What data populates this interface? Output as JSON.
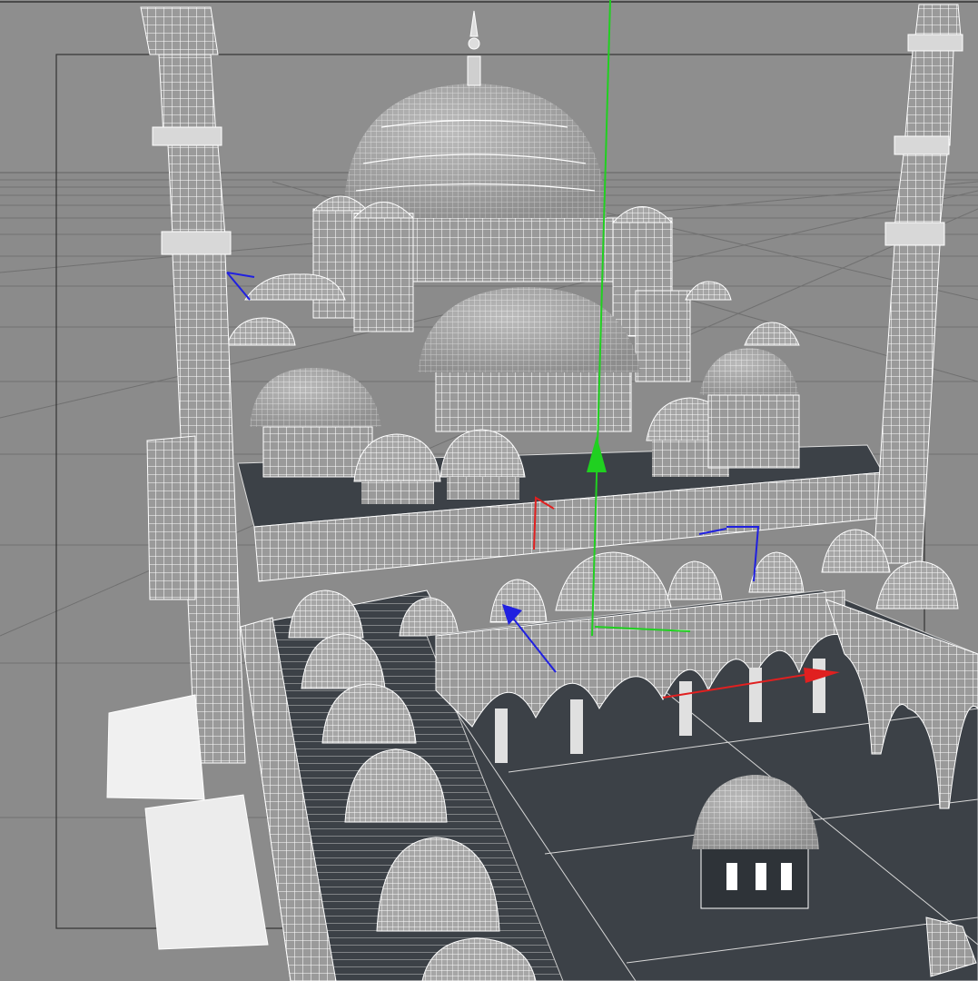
{
  "viewport": {
    "kind": "3d-viewport",
    "render_mode": "wireframe-shaded",
    "background_color": "#8e8e8e",
    "ground_grid_color": "#5f5f5f",
    "model_shade_color": "#c8c8c8",
    "wire_color": "#ffffff",
    "floor_color": "#3c4147"
  },
  "gizmo": {
    "x_axis_color": "#e02020",
    "y_axis_color": "#20d020",
    "z_axis_color": "#2020e0"
  },
  "model": {
    "subject": "mosque-wireframe",
    "icons": [
      "main-dome-icon",
      "minaret-icon",
      "small-dome-icon",
      "fountain-kiosk-icon",
      "arcade-icon"
    ]
  }
}
